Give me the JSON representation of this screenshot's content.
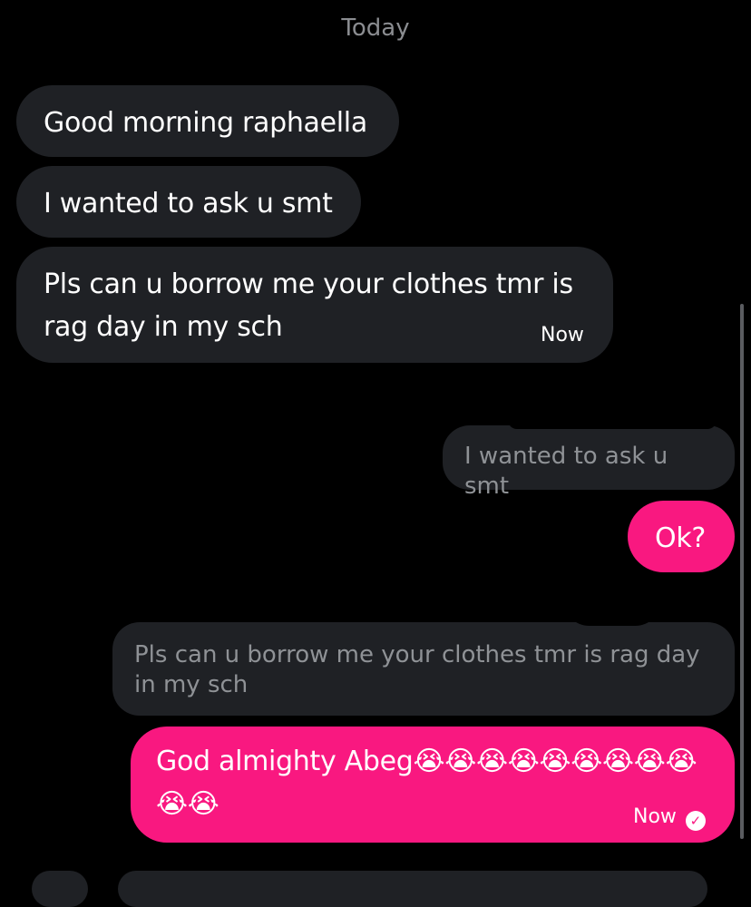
{
  "conversation": {
    "date_divider": "Today",
    "messages": [
      {
        "text": "Good morning raphaella"
      },
      {
        "text": "I wanted to ask u smt"
      },
      {
        "text": "Pls can u borrow me your clothes tmr is rag day in my sch",
        "time": "Now"
      }
    ],
    "replies": [
      {
        "quoted": "I wanted to ask u smt",
        "text": "Ok?"
      },
      {
        "quoted": "Pls can u borrow me your clothes tmr is rag day in my sch",
        "text": "God almighty Abeg😭😭😭😭😭😭😭😭😭😭😭",
        "time": "Now",
        "status_icon": "check-circle-icon"
      }
    ]
  },
  "colors": {
    "background": "#000000",
    "incoming_bubble": "#1f2125",
    "outgoing_bubble": "#f91880",
    "muted_text": "#8f9296"
  }
}
